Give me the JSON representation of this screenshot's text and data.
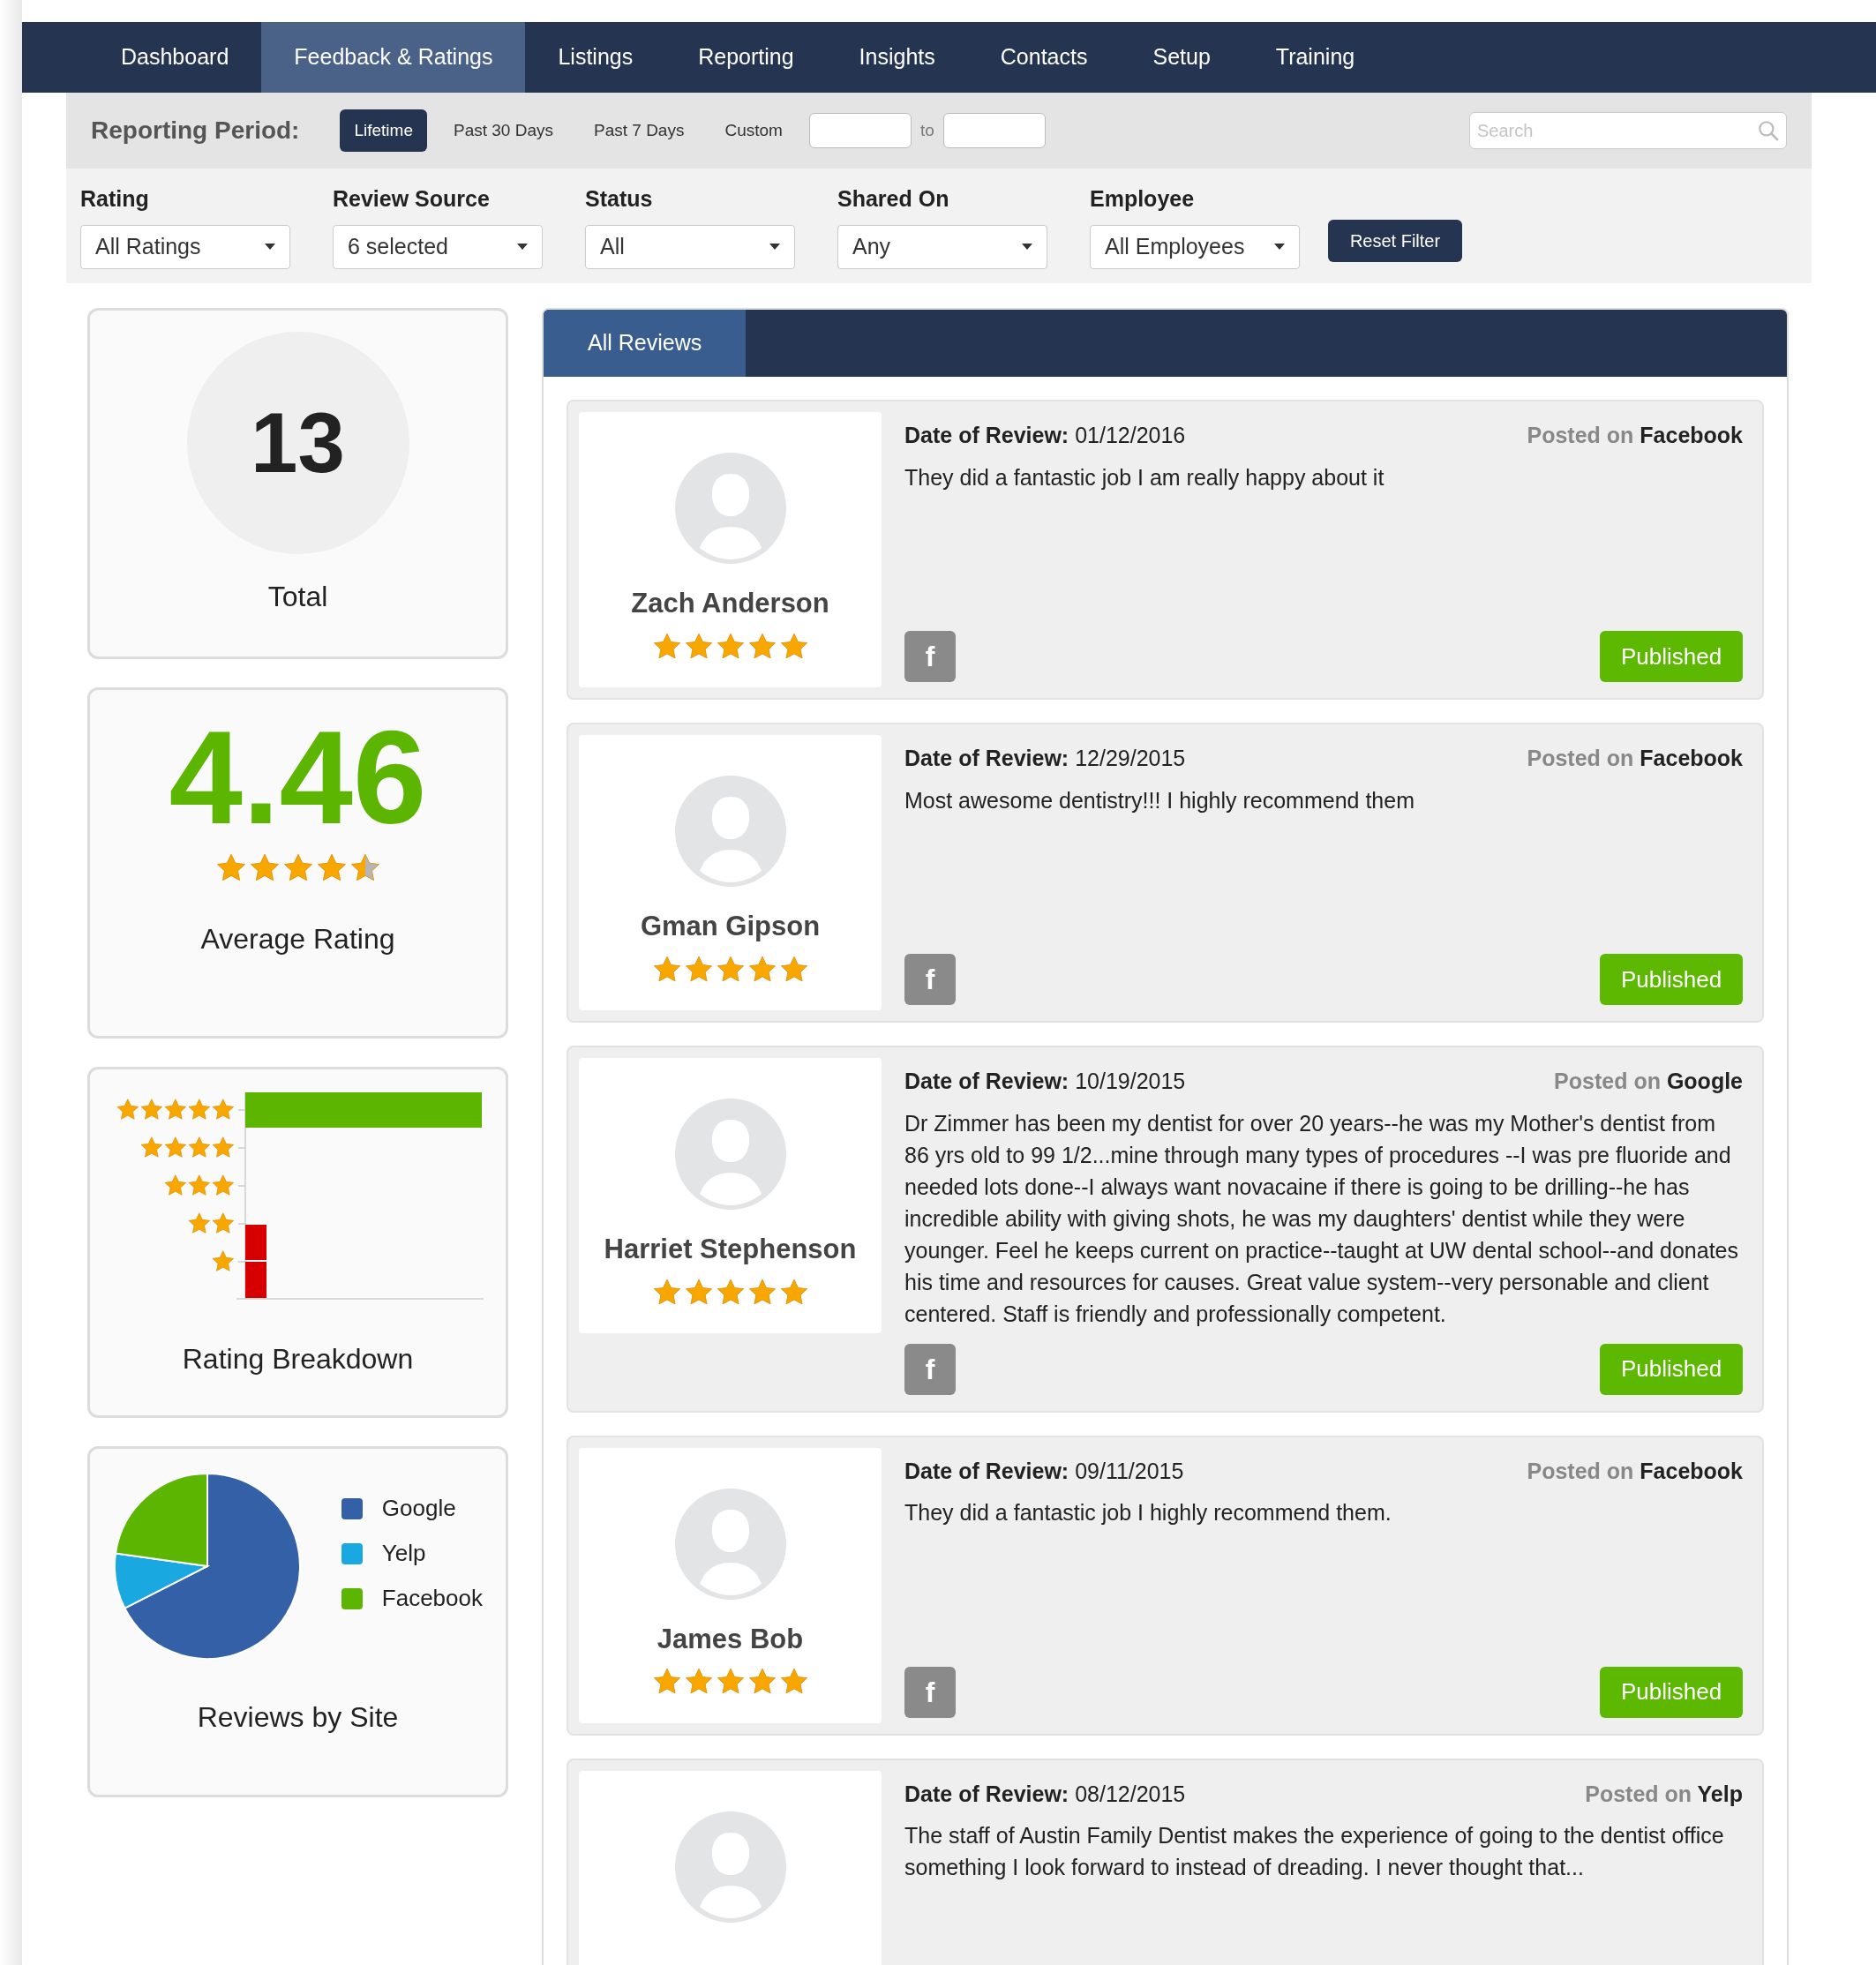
{
  "nav": [
    {
      "label": "Dashboard",
      "selected": false
    },
    {
      "label": "Feedback & Ratings",
      "selected": true
    },
    {
      "label": "Listings",
      "selected": false
    },
    {
      "label": "Reporting",
      "selected": false
    },
    {
      "label": "Insights",
      "selected": false
    },
    {
      "label": "Contacts",
      "selected": false
    },
    {
      "label": "Setup",
      "selected": false
    },
    {
      "label": "Training",
      "selected": false
    }
  ],
  "reporting_period": {
    "label": "Reporting Period:",
    "options": [
      {
        "label": "Lifetime",
        "selected": true
      },
      {
        "label": "Past 30 Days",
        "selected": false
      },
      {
        "label": "Past 7 Days",
        "selected": false
      },
      {
        "label": "Custom",
        "selected": false
      }
    ],
    "to_label": "to",
    "search": {
      "placeholder": "Search"
    }
  },
  "filters": [
    {
      "label": "Rating",
      "value": "All Ratings"
    },
    {
      "label": "Review Source",
      "value": "6 selected"
    },
    {
      "label": "Status",
      "value": "All"
    },
    {
      "label": "Shared On",
      "value": "Any"
    },
    {
      "label": "Employee",
      "value": "All Employees"
    }
  ],
  "reset_button": "Reset Filter",
  "total": {
    "value": "13",
    "label": "Total"
  },
  "average": {
    "value": "4.46",
    "stars": 4.5,
    "label": "Average Rating"
  },
  "breakdown": {
    "label": "Rating Breakdown"
  },
  "by_site": {
    "legend": [
      {
        "name": "Google",
        "color": "#3360a6"
      },
      {
        "name": "Yelp",
        "color": "#1aa8e0"
      },
      {
        "name": "Facebook",
        "color": "#5cb500"
      }
    ],
    "label": "Reviews by Site"
  },
  "tabs": [
    {
      "label": "All Reviews",
      "selected": true
    }
  ],
  "reviews": [
    {
      "name": "Zach Anderson",
      "stars": 5,
      "date_label": "Date of Review:",
      "date": "01/12/2016",
      "posted_label": "Posted on",
      "site": "Facebook",
      "text": "They did a fantastic job I am really happy about it",
      "share_icon": "f",
      "status": "Published"
    },
    {
      "name": "Gman Gipson",
      "stars": 5,
      "date_label": "Date of Review:",
      "date": "12/29/2015",
      "posted_label": "Posted on",
      "site": "Facebook",
      "text": "Most awesome dentistry!!! I highly recommend them",
      "share_icon": "f",
      "status": "Published"
    },
    {
      "name": "Harriet Stephenson",
      "stars": 5,
      "date_label": "Date of Review:",
      "date": "10/19/2015",
      "posted_label": "Posted on",
      "site": "Google",
      "text": "Dr Zimmer has been my dentist for over 20 years--he was my Mother's dentist from 86 yrs old to 99 1/2...mine through many types of procedures --I was pre fluoride and needed lots done--I always want novacaine if there is going to be drilling--he has incredible ability with giving shots, he was my daughters' dentist while they were younger. Feel he keeps current on practice--taught at UW dental school--and donates his time and resources for causes. Great value system--very personable and client centered. Staff is friendly and professionally competent.",
      "share_icon": "f",
      "status": "Published"
    },
    {
      "name": "James Bob",
      "stars": 5,
      "date_label": "Date of Review:",
      "date": "09/11/2015",
      "posted_label": "Posted on",
      "site": "Facebook",
      "text": "They did a fantastic job I highly recommend them.",
      "share_icon": "f",
      "status": "Published"
    },
    {
      "date_label": "Date of Review:",
      "date": "08/12/2015",
      "posted_label": "Posted on",
      "site": "Yelp",
      "text": "The staff of Austin Family Dentist makes the experience of going to the dentist office something I look forward to instead of dreading. I never thought that..."
    }
  ]
}
